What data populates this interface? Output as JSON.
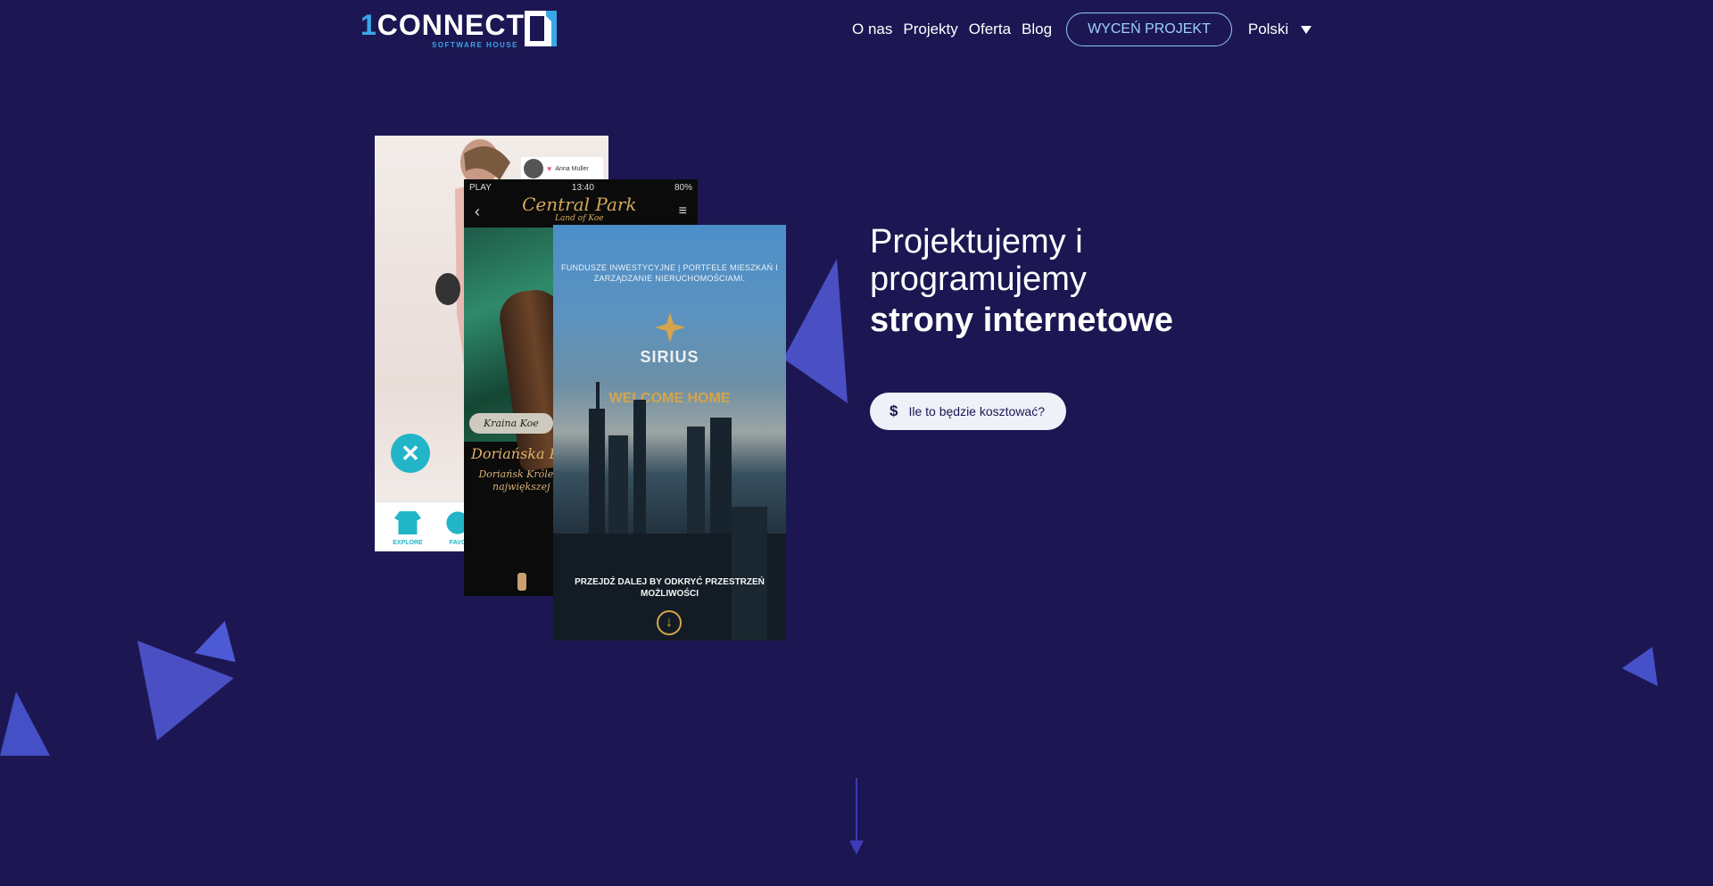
{
  "logo": {
    "brand": "CONNECT",
    "prefix": "1",
    "subtitle": "SOFTWARE HOUSE"
  },
  "nav": {
    "items": [
      "O nas",
      "Projekty",
      "Oferta",
      "Blog"
    ],
    "cta": "WYCEŃ PROJEKT",
    "language": "Polski"
  },
  "hero": {
    "line1": "Projektujemy i",
    "line2": "programujemy",
    "line3": "strony internetowe",
    "button": "Ile to będzie kosztować?"
  },
  "phone1": {
    "profile_name": "Anna Muller",
    "tab_explore": "EXPLORE",
    "tab_favorites": "FAVO"
  },
  "phone2": {
    "carrier": "PLAY",
    "time": "13:40",
    "battery": "80%",
    "brand": "Central Park",
    "brand_sub": "Land of Koe",
    "chip": "Kraina Koe",
    "title": "Doriańska Pu",
    "desc": "Doriańsk Królestwie Koe ścieżkach i nie największej opo drzewa stały się b"
  },
  "phone3": {
    "tagline": "FUNDUSZE INWESTYCYJNE | PORTFELE MIESZKAŃ I ZARZĄDZANIE NIERUCHOMOŚCIAMI.",
    "brand": "SIRIUS",
    "welcome": "WELCOME HOME",
    "more": "PRZEJDŹ DALEJ BY ODKRYĆ PRZESTRZEŃ MOŻLIWOŚCI"
  },
  "colors": {
    "background": "#1c1752",
    "accent": "#3aa6e8",
    "gold": "#d4a44d",
    "teal": "#22b5c8"
  }
}
